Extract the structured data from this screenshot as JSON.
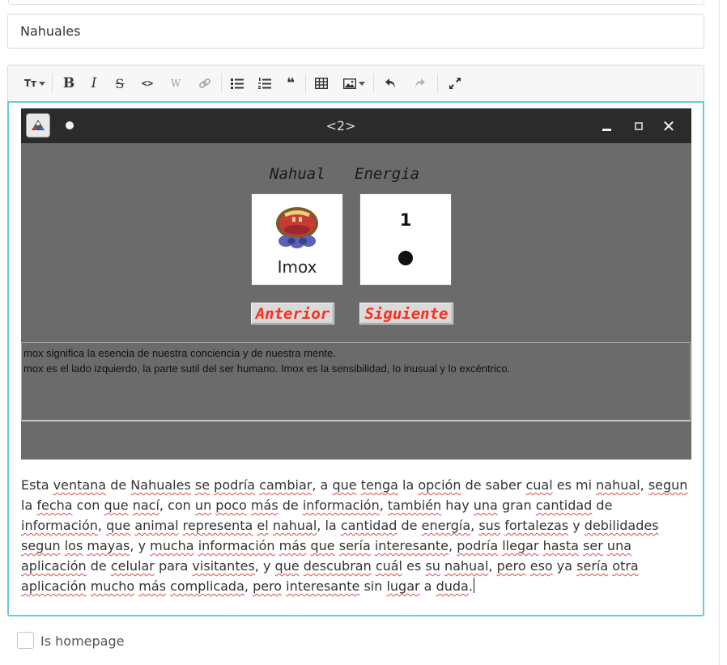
{
  "form": {
    "title_value": "Nahuales",
    "homepage_label": "Is homepage",
    "homepage_checked": false
  },
  "toolbar": {
    "buttons": [
      {
        "name": "text-size",
        "glyph": "Tт"
      },
      {
        "name": "bold",
        "glyph": "B"
      },
      {
        "name": "italic",
        "glyph": "I"
      },
      {
        "name": "strikethrough",
        "glyph": "S"
      },
      {
        "name": "code",
        "glyph": "<>"
      },
      {
        "name": "wiki",
        "glyph": "W"
      },
      {
        "name": "link",
        "glyph": "link-icon"
      },
      {
        "name": "bullet-list",
        "glyph": "bullet-list-icon"
      },
      {
        "name": "numbered-list",
        "glyph": "numbered-list-icon"
      },
      {
        "name": "quote",
        "glyph": "quote-icon"
      },
      {
        "name": "table",
        "glyph": "table-icon"
      },
      {
        "name": "image",
        "glyph": "image-icon"
      },
      {
        "name": "undo",
        "glyph": "undo-icon"
      },
      {
        "name": "redo",
        "glyph": "redo-icon"
      },
      {
        "name": "fullscreen",
        "glyph": "expand-icon"
      }
    ],
    "labels": {
      "text_size": "Tт",
      "bold": "B",
      "italic": "I",
      "strike": "S",
      "code": "<>",
      "wiki": "W",
      "quote": "❝"
    }
  },
  "embedded_app": {
    "window_title": "<2>",
    "col_nahual": "Nahual",
    "col_energy": "Energia",
    "nahual_name": "Imox",
    "energy_number": "1",
    "energy_dots": 1,
    "btn_prev": "Anterior",
    "btn_next": "Siguiente",
    "description": [
      "mox significa la esencia de nuestra conciencia y de nuestra mente.",
      "mox es el lado izquierdo, la parte sutil del ser humano. Imox es la sensibilidad, lo inusual y lo excéntrico."
    ],
    "colors": {
      "titlebar": "#2b2b2b",
      "panel": "#6b6b6b",
      "button_text": "#ff2d1a"
    }
  },
  "body_paragraph": "Esta ventana de Nahuales se podría cambiar, a que tenga la opción de saber cual es mi nahual, segun la fecha con que nací, con un poco más de información, también  hay una gran cantidad de información, que animal representa el nahual, la cantidad de energía, sus fortalezas y debilidades segun los mayas, y mucha información más que sería interesante, podría llegar hasta ser una aplicación de celular para visitantes, y que descubran cuál es su nahual, pero eso ya sería otra aplicación mucho más complicada, pero interesante sin lugar a duda.",
  "spellcheck_words": [
    "ventana",
    "Nahuales",
    "se",
    "podría",
    "cambiar",
    "que",
    "tenga",
    "opción",
    "cual",
    "nahual",
    "segun",
    "fecha",
    "que",
    "nací",
    "un",
    "poco",
    "más",
    "información",
    "también",
    "una",
    "cantidad",
    "información",
    "que",
    "animal",
    "representa",
    "el",
    "nahual",
    "cantidad",
    "energía",
    "sus",
    "fortalezas",
    "debilidades",
    "segun",
    "los",
    "mayas",
    "mucha",
    "información",
    "más",
    "que",
    "sería",
    "interesante",
    "podría",
    "llegar",
    "hasta",
    "ser",
    "una",
    "aplicación",
    "celular",
    "visitantes",
    "que",
    "descubran",
    "cuál",
    "su",
    "nahual",
    "pero",
    "eso",
    "sería",
    "otra",
    "aplicación",
    "mucho",
    "más",
    "complicada",
    "pero",
    "interesante",
    "lugar",
    "duda"
  ],
  "accent_color": "#66c9e6"
}
